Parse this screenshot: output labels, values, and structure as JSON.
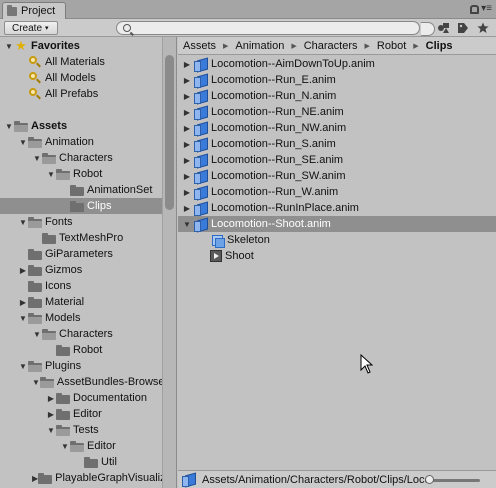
{
  "window": {
    "tab_title": "Project",
    "menu_glyph": "▾≡"
  },
  "toolbar": {
    "create_label": "Create",
    "create_caret": "▾",
    "search_placeholder": "",
    "icons": [
      "filter-by-type-icon",
      "filter-by-label-icon",
      "favorite-star-icon"
    ]
  },
  "tree": {
    "items": [
      {
        "label": "Favorites",
        "icon": "star",
        "arrow": "▼",
        "depth": 0,
        "bold": true
      },
      {
        "label": "All Materials",
        "icon": "search",
        "arrow": "",
        "depth": 1
      },
      {
        "label": "All Models",
        "icon": "search",
        "arrow": "",
        "depth": 1
      },
      {
        "label": "All Prefabs",
        "icon": "search",
        "arrow": "",
        "depth": 1
      },
      {
        "label": "",
        "icon": "",
        "arrow": "",
        "depth": 0,
        "spacer": true
      },
      {
        "label": "Assets",
        "icon": "folder",
        "arrow": "▼",
        "depth": 0,
        "bold": true
      },
      {
        "label": "Animation",
        "icon": "folder",
        "arrow": "▼",
        "depth": 1
      },
      {
        "label": "Characters",
        "icon": "folder",
        "arrow": "▼",
        "depth": 2
      },
      {
        "label": "Robot",
        "icon": "folder",
        "arrow": "▼",
        "depth": 3
      },
      {
        "label": "AnimationSet",
        "icon": "folder",
        "arrow": "",
        "depth": 4
      },
      {
        "label": "Clips",
        "icon": "folder",
        "arrow": "",
        "depth": 4,
        "selected": true
      },
      {
        "label": "Fonts",
        "icon": "folder",
        "arrow": "▼",
        "depth": 1
      },
      {
        "label": "TextMeshPro",
        "icon": "folder",
        "arrow": "",
        "depth": 2
      },
      {
        "label": "GiParameters",
        "icon": "folder",
        "arrow": "",
        "depth": 1
      },
      {
        "label": "Gizmos",
        "icon": "folder",
        "arrow": "▶",
        "depth": 1
      },
      {
        "label": "Icons",
        "icon": "folder",
        "arrow": "",
        "depth": 1
      },
      {
        "label": "Material",
        "icon": "folder",
        "arrow": "▶",
        "depth": 1
      },
      {
        "label": "Models",
        "icon": "folder",
        "arrow": "▼",
        "depth": 1
      },
      {
        "label": "Characters",
        "icon": "folder",
        "arrow": "▼",
        "depth": 2
      },
      {
        "label": "Robot",
        "icon": "folder",
        "arrow": "",
        "depth": 3
      },
      {
        "label": "Plugins",
        "icon": "folder",
        "arrow": "▼",
        "depth": 1
      },
      {
        "label": "AssetBundles-Browser",
        "icon": "folder",
        "arrow": "▼",
        "depth": 2
      },
      {
        "label": "Documentation",
        "icon": "folder",
        "arrow": "▶",
        "depth": 3
      },
      {
        "label": "Editor",
        "icon": "folder",
        "arrow": "▶",
        "depth": 3
      },
      {
        "label": "Tests",
        "icon": "folder",
        "arrow": "▼",
        "depth": 3
      },
      {
        "label": "Editor",
        "icon": "folder",
        "arrow": "▼",
        "depth": 4
      },
      {
        "label": "Util",
        "icon": "folder",
        "arrow": "",
        "depth": 5
      },
      {
        "label": "PlayableGraphVisualizer",
        "icon": "folder",
        "arrow": "▶",
        "depth": 2
      }
    ]
  },
  "breadcrumb": {
    "parts": [
      "Assets",
      "Animation",
      "Characters",
      "Robot"
    ],
    "current": "Clips",
    "separator": "▶"
  },
  "assets": {
    "items": [
      {
        "label": "Locomotion--AimDownToUp.anim",
        "icon": "anim",
        "arrow": "▶",
        "depth": 0
      },
      {
        "label": "Locomotion--Run_E.anim",
        "icon": "anim",
        "arrow": "▶",
        "depth": 0
      },
      {
        "label": "Locomotion--Run_N.anim",
        "icon": "anim",
        "arrow": "▶",
        "depth": 0
      },
      {
        "label": "Locomotion--Run_NE.anim",
        "icon": "anim",
        "arrow": "▶",
        "depth": 0
      },
      {
        "label": "Locomotion--Run_NW.anim",
        "icon": "anim",
        "arrow": "▶",
        "depth": 0
      },
      {
        "label": "Locomotion--Run_S.anim",
        "icon": "anim",
        "arrow": "▶",
        "depth": 0
      },
      {
        "label": "Locomotion--Run_SE.anim",
        "icon": "anim",
        "arrow": "▶",
        "depth": 0
      },
      {
        "label": "Locomotion--Run_SW.anim",
        "icon": "anim",
        "arrow": "▶",
        "depth": 0
      },
      {
        "label": "Locomotion--Run_W.anim",
        "icon": "anim",
        "arrow": "▶",
        "depth": 0
      },
      {
        "label": "Locomotion--RunInPlace.anim",
        "icon": "anim",
        "arrow": "▶",
        "depth": 0
      },
      {
        "label": "Locomotion--Shoot.anim",
        "icon": "anim",
        "arrow": "▼",
        "depth": 0,
        "selected": true
      },
      {
        "label": "Skeleton",
        "icon": "mesh",
        "arrow": "",
        "depth": 1
      },
      {
        "label": "Shoot",
        "icon": "clip",
        "arrow": "",
        "depth": 1
      }
    ]
  },
  "statusbar": {
    "path": "Assets/Animation/Characters/Robot/Clips/Locomotion--Shoot.anim",
    "zoom": 0
  },
  "colors": {
    "selection": "#8f8f8f",
    "panel": "#c2c2c2",
    "anim_blue": "#3a7ad8",
    "favorite_star": "#e0b000"
  }
}
